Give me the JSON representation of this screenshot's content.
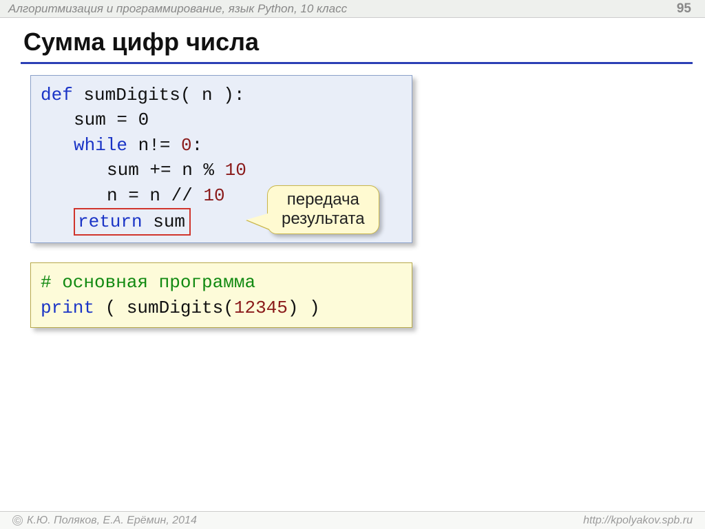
{
  "header": {
    "course": "Алгоритмизация и программирование, язык Python, 10 класс",
    "page": "95"
  },
  "title": "Сумма цифр числа",
  "code1": {
    "l1_def": "def",
    "l1_name": " sumDigits( n ):",
    "l2": "sum = 0",
    "l3_while": "while",
    "l3_cond": " n!= ",
    "l3_zero": "0",
    "l3_colon": ":",
    "l4_a": "sum += n % ",
    "l4_ten": "10",
    "l5_a": "n = n // ",
    "l5_ten": "10",
    "l6_ret": "return",
    "l6_sum": " sum"
  },
  "callout": {
    "line1": "передача",
    "line2": "результата"
  },
  "code2": {
    "comment": "# основная программа",
    "print": "print",
    "open": " ( ",
    "call": "sumDigits(",
    "arg": "12345",
    "close": ")",
    "outer_close": " )"
  },
  "footer": {
    "left": "К.Ю. Поляков, Е.А. Ерёмин, 2014",
    "right": "http://kpolyakov.spb.ru"
  }
}
